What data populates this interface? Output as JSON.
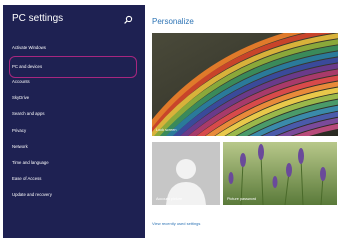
{
  "sidebar": {
    "title": "PC settings",
    "search_icon": "search-icon",
    "items": [
      {
        "label": "Activate Windows"
      },
      {
        "label": "PC and devices",
        "selected": true
      },
      {
        "label": "Accounts"
      },
      {
        "label": "SkyDrive"
      },
      {
        "label": "Search and apps"
      },
      {
        "label": "Privacy"
      },
      {
        "label": "Network"
      },
      {
        "label": "Time and language"
      },
      {
        "label": "Ease of Access"
      },
      {
        "label": "Update and recovery"
      }
    ],
    "highlight_color": "#a7267f",
    "background": "#1e2152"
  },
  "main": {
    "title": "Personalize",
    "lock_screen_label": "Lock screen",
    "account_picture_label": "Account picture",
    "picture_password_label": "Picture password",
    "view_link": "View recently used settings",
    "accent_color": "#2e74b5"
  }
}
